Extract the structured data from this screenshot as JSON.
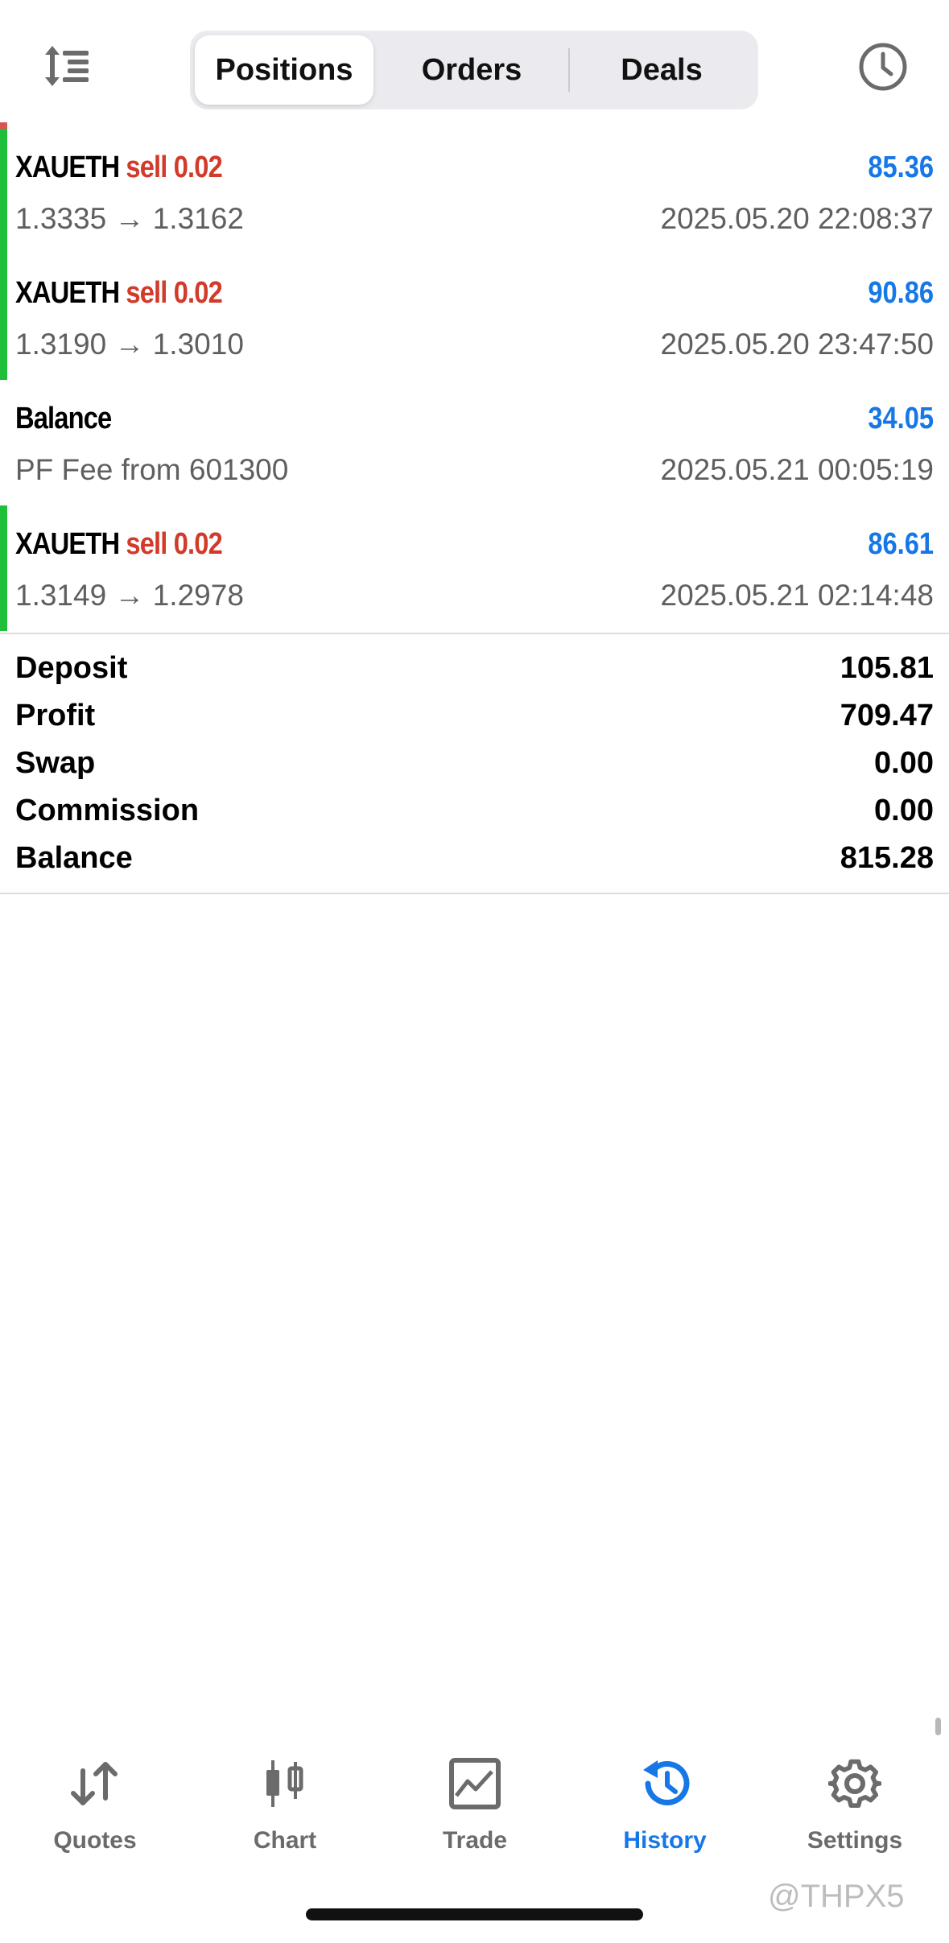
{
  "tabs": [
    {
      "label": "Positions",
      "active": true
    },
    {
      "label": "Orders",
      "active": false
    },
    {
      "label": "Deals",
      "active": false
    }
  ],
  "deals": [
    {
      "symbol": "XAUETH",
      "action": "sell 0.02",
      "profit": "85.36",
      "prices": "1.3335 → 1.3162",
      "time": "2025.05.20 22:08:37",
      "bar": true
    },
    {
      "symbol": "XAUETH",
      "action": "sell 0.02",
      "profit": "90.86",
      "prices": "1.3190 → 1.3010",
      "time": "2025.05.20 23:47:50",
      "bar": true
    },
    {
      "symbol": "Balance",
      "action": "",
      "profit": "34.05",
      "prices": "PF Fee from 601300",
      "time": "2025.05.21 00:05:19",
      "bar": false
    },
    {
      "symbol": "XAUETH",
      "action": "sell 0.02",
      "profit": "86.61",
      "prices": "1.3149 → 1.2978",
      "time": "2025.05.21 02:14:48",
      "bar": true
    }
  ],
  "summary": [
    {
      "label": "Deposit",
      "value": "105.81"
    },
    {
      "label": "Profit",
      "value": "709.47"
    },
    {
      "label": "Swap",
      "value": "0.00"
    },
    {
      "label": "Commission",
      "value": "0.00"
    },
    {
      "label": "Balance",
      "value": "815.28"
    }
  ],
  "bottom_nav": [
    {
      "label": "Quotes",
      "icon": "quotes-arrows-icon",
      "active": false
    },
    {
      "label": "Chart",
      "icon": "candlestick-icon",
      "active": false
    },
    {
      "label": "Trade",
      "icon": "trade-chart-icon",
      "active": false
    },
    {
      "label": "History",
      "icon": "history-clock-icon",
      "active": true
    },
    {
      "label": "Settings",
      "icon": "gear-icon",
      "active": false
    }
  ],
  "watermark": "@THPX5",
  "colors": {
    "accent_blue": "#1677e6",
    "sell_red": "#d23a2a",
    "position_green": "#1fbf3a",
    "inactive_gray": "#6b6b6b"
  }
}
